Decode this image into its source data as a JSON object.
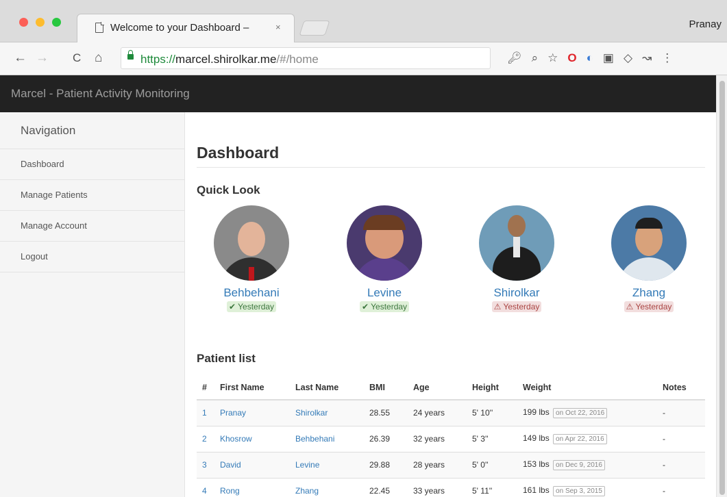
{
  "browser": {
    "tab_title": "Welcome to your Dashboard –",
    "tab_close": "×",
    "profile_name": "Pranay",
    "url_scheme": "https://",
    "url_host": "marcel.shirolkar.me",
    "url_path": "/#/home",
    "nav_icons": {
      "back": "←",
      "forward": "→",
      "reload": "C",
      "home": "⌂"
    },
    "toolbar_icons": [
      "key-icon",
      "zoom-icon",
      "star-icon",
      "opera-icon",
      "extension-blue-icon",
      "extension-grey-icon",
      "diamond-icon",
      "extension-arrow-icon",
      "menu-icon"
    ]
  },
  "app": {
    "brand": "Marcel - Patient Activity Monitoring",
    "colors": {
      "header_bg": "#222222",
      "link": "#337ab7",
      "ok_bg": "#dff0d8",
      "ok_fg": "#3c763d",
      "warn_bg": "#f2dede",
      "warn_fg": "#a94442"
    }
  },
  "sidebar": {
    "heading": "Navigation",
    "items": [
      {
        "label": "Dashboard"
      },
      {
        "label": "Manage Patients"
      },
      {
        "label": "Manage Account"
      },
      {
        "label": "Logout"
      }
    ]
  },
  "main": {
    "title": "Dashboard",
    "quick_look_title": "Quick Look",
    "quick_look": [
      {
        "name": "Behbehani",
        "status": "ok",
        "status_icon": "✔",
        "status_text": "Yesterday"
      },
      {
        "name": "Levine",
        "status": "ok",
        "status_icon": "✔",
        "status_text": "Yesterday"
      },
      {
        "name": "Shirolkar",
        "status": "warn",
        "status_icon": "⚠",
        "status_text": "Yesterday"
      },
      {
        "name": "Zhang",
        "status": "warn",
        "status_icon": "⚠",
        "status_text": "Yesterday"
      }
    ],
    "patient_list_title": "Patient list",
    "table": {
      "headers": [
        "#",
        "First Name",
        "Last Name",
        "BMI",
        "Age",
        "Height",
        "Weight",
        "Notes"
      ],
      "rows": [
        {
          "num": "1",
          "first": "Pranay",
          "last": "Shirolkar",
          "bmi": "28.55",
          "age": "24 years",
          "height": "5' 10''",
          "weight": "199 lbs",
          "weight_date": "on Oct 22, 2016",
          "notes": "-"
        },
        {
          "num": "2",
          "first": "Khosrow",
          "last": "Behbehani",
          "bmi": "26.39",
          "age": "32 years",
          "height": "5' 3''",
          "weight": "149 lbs",
          "weight_date": "on Apr 22, 2016",
          "notes": "-"
        },
        {
          "num": "3",
          "first": "David",
          "last": "Levine",
          "bmi": "29.88",
          "age": "28 years",
          "height": "5' 0''",
          "weight": "153 lbs",
          "weight_date": "on Dec 9, 2016",
          "notes": "-"
        },
        {
          "num": "4",
          "first": "Rong",
          "last": "Zhang",
          "bmi": "22.45",
          "age": "33 years",
          "height": "5' 11''",
          "weight": "161 lbs",
          "weight_date": "on Sep 3, 2015",
          "notes": "-"
        }
      ]
    }
  }
}
